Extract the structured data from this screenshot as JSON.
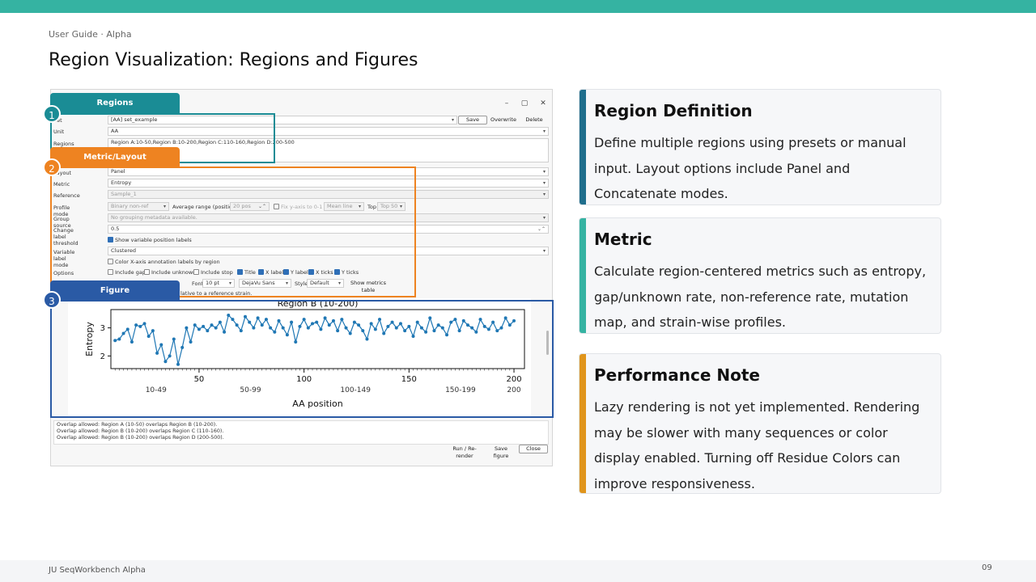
{
  "header": {
    "kicker": "User Guide · Alpha",
    "title": "Region Visualization: Regions and Figures"
  },
  "window": {
    "minimize": "–",
    "maximize": "▢",
    "close": "✕"
  },
  "form": {
    "set_label": "Set",
    "set_value": "[AA] set_example",
    "save": "Save",
    "overwrite": "Overwrite",
    "delete": "Delete",
    "unit_label": "Unit",
    "unit_value": "AA",
    "regions_label": "Regions",
    "regions_value": "Region A:10-50,Region B:10-200,Region C:110-160,Region D:200-500",
    "layout_label": "Layout",
    "layout_value": "Panel",
    "metric_label": "Metric",
    "metric_value": "Entropy",
    "reference_label": "Reference",
    "reference_value": "Sample_1",
    "profile_mode_label": "Profile mode",
    "profile_mode_value": "Binary non-ref",
    "avg_range_label": "Average range (positions)",
    "avg_range_value": "20 pos",
    "fix_y_label": "Fix y-axis to 0-1",
    "mean_value": "Mean line",
    "top_label": "Top",
    "top_value": "Top 50",
    "group_source_label": "Group source",
    "group_source_value": "No grouping metadata available.",
    "change_threshold_label": "Change label threshold",
    "change_threshold_value": "0.5",
    "show_var_labels": "Show variable position labels",
    "var_label_mode_label": "Variable label mode",
    "var_label_mode_value": "Clustered",
    "color_xaxis": "Color X-axis annotation labels by region",
    "options_label": "Options",
    "include_gap": "Include gap",
    "include_unknown": "Include unknown",
    "include_stop": "Include stop",
    "opt_title": "Title",
    "opt_xlabel": "X label",
    "opt_ylabel": "Y label",
    "opt_xticks": "X ticks",
    "opt_yticks": "Y ticks",
    "font_label": "Font",
    "font_size": "10 pt",
    "font_family": "DejaVu Sans",
    "style_label": "Style",
    "style_value": "Default",
    "show_metrics": "Show metrics table",
    "relative_note": "lative to a reference strain."
  },
  "callouts": {
    "regions": {
      "num": "1",
      "label": "Regions"
    },
    "metric": {
      "num": "2",
      "label": "Metric/Layout"
    },
    "figure": {
      "num": "3",
      "label": "Figure"
    }
  },
  "log": [
    "Overlap allowed: Region A (10-50) overlaps Region B (10-200).",
    "Overlap allowed: Region B (10-200) overlaps Region C (110-160).",
    "Overlap allowed: Region B (10-200) overlaps Region D (200-500)."
  ],
  "bottom_buttons": {
    "run": "Run / Re-render",
    "save_figure": "Save figure",
    "close": "Close"
  },
  "chart_data": {
    "type": "line",
    "title": "Region B (10-200)",
    "xlabel": "AA position",
    "ylabel": "Entropy",
    "xlim": [
      8,
      205
    ],
    "ylim": [
      1.55,
      3.65
    ],
    "xticks": [
      50,
      100,
      150,
      200
    ],
    "yticks": [
      2,
      3
    ],
    "range_labels": [
      {
        "label": "10-49",
        "x": 29.5
      },
      {
        "label": "50-99",
        "x": 74.5
      },
      {
        "label": "100-149",
        "x": 124.5
      },
      {
        "label": "150-199",
        "x": 174.5
      },
      {
        "label": "200",
        "x": 200
      }
    ],
    "series_color": "#1f77b4",
    "x": [
      10,
      12,
      14,
      16,
      18,
      20,
      22,
      24,
      26,
      28,
      30,
      32,
      34,
      36,
      38,
      40,
      42,
      44,
      46,
      48,
      50,
      52,
      54,
      56,
      58,
      60,
      62,
      64,
      66,
      68,
      70,
      72,
      74,
      76,
      78,
      80,
      82,
      84,
      86,
      88,
      90,
      92,
      94,
      96,
      98,
      100,
      102,
      104,
      106,
      108,
      110,
      112,
      114,
      116,
      118,
      120,
      122,
      124,
      126,
      128,
      130,
      132,
      134,
      136,
      138,
      140,
      142,
      144,
      146,
      148,
      150,
      152,
      154,
      156,
      158,
      160,
      162,
      164,
      166,
      168,
      170,
      172,
      174,
      176,
      178,
      180,
      182,
      184,
      186,
      188,
      190,
      192,
      194,
      196,
      198,
      200
    ],
    "values": [
      2.55,
      2.6,
      2.8,
      2.95,
      2.5,
      3.1,
      3.05,
      3.15,
      2.7,
      2.9,
      2.1,
      2.4,
      1.8,
      2.0,
      2.6,
      1.7,
      2.3,
      3.0,
      2.5,
      3.1,
      2.95,
      3.05,
      2.9,
      3.1,
      3.0,
      3.2,
      2.85,
      3.45,
      3.3,
      3.1,
      2.9,
      3.4,
      3.2,
      3.0,
      3.35,
      3.1,
      3.3,
      3.0,
      2.85,
      3.25,
      3.0,
      2.75,
      3.2,
      2.5,
      3.05,
      3.3,
      3.0,
      3.15,
      3.2,
      2.95,
      3.35,
      3.1,
      3.25,
      2.9,
      3.3,
      3.0,
      2.8,
      3.2,
      3.1,
      2.9,
      2.6,
      3.15,
      2.95,
      3.3,
      2.8,
      3.05,
      3.2,
      3.0,
      3.15,
      2.9,
      3.05,
      2.7,
      3.2,
      3.0,
      2.85,
      3.35,
      2.9,
      3.1,
      3.0,
      2.75,
      3.2,
      3.3,
      2.9,
      3.25,
      3.1,
      3.0,
      2.85,
      3.3,
      3.05,
      2.95,
      3.2,
      2.9,
      3.0,
      3.35,
      3.1,
      3.25
    ]
  },
  "cards": [
    {
      "title": "Region Definition",
      "body": "Define multiple regions using presets or manual input. Layout options include Panel and Concatenate modes.",
      "color": "#1f6e8c"
    },
    {
      "title": "Metric",
      "body": "Calculate region-centered metrics such as entropy, gap/unknown rate, non-reference rate, mutation map, and strain-wise profiles.",
      "color": "#35b3a2"
    },
    {
      "title": "Performance Note",
      "body": "Lazy rendering is not yet implemented. Rendering may be slower with many sequences or color display enabled. Turning off Residue Colors can improve responsiveness.",
      "color": "#e0951c"
    }
  ],
  "footer": {
    "left": "JU SeqWorkbench Alpha",
    "page": "09"
  },
  "colors": {
    "regions": "#1a8c95",
    "metric": "#ee8321",
    "figure": "#2a5aa5"
  }
}
